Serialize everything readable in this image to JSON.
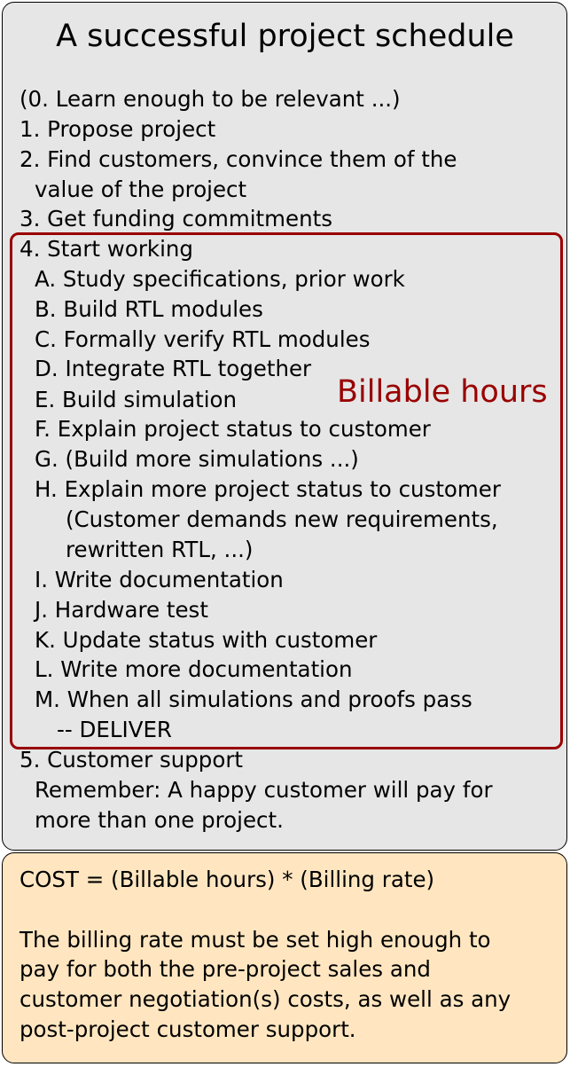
{
  "title": "A successful project schedule",
  "schedule": {
    "step0": "(0. Learn enough to be relevant ...)",
    "step1": "1. Propose project",
    "step2": [
      "2. Find customers, convince them of the",
      "value of the project"
    ],
    "step3": "3. Get funding commitments",
    "step4": {
      "label": "4. Start working",
      "substeps": {
        "a": "A. Study specifications, prior work",
        "b": "B. Build RTL modules",
        "c": "C. Formally verify RTL modules",
        "d": "D. Integrate RTL together",
        "e": "E. Build simulation",
        "f": "F. Explain project status to customer",
        "g": "G. (Build more simulations ...)",
        "h": [
          "H. Explain more project status to customer",
          "(Customer demands new requirements,",
          "rewritten RTL, ...)"
        ],
        "i": "I. Write documentation",
        "j": "J. Hardware test",
        "k": "K. Update status with customer",
        "l": "L. Write more documentation",
        "m": [
          "M. When all simulations and proofs pass",
          "-- DELIVER"
        ]
      }
    },
    "step5": [
      "5. Customer support",
      "Remember: A happy customer will pay for",
      "more than one project."
    ],
    "billable_label": "Billable hours",
    "billable_color": "#990000"
  },
  "cost": {
    "formula": "COST = (Billable hours) * (Billing rate)",
    "note": [
      "The billing rate must be set high enough to",
      "pay for both the pre-project sales and",
      "customer negotiation(s) costs, as well as any",
      "post-project customer support."
    ]
  },
  "colors": {
    "schedule_fill": "#e6e6e6",
    "cost_fill": "#ffe6c0",
    "frame": "#990000"
  }
}
